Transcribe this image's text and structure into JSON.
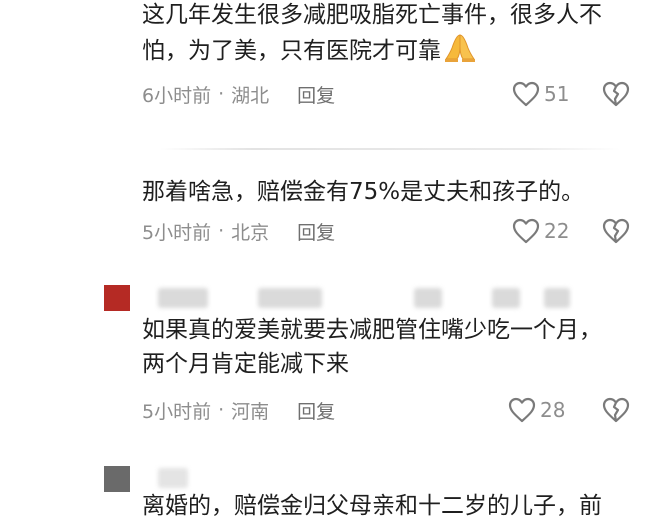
{
  "comments": [
    {
      "text": "这几年发生很多减肥吸脂死亡事件，很多人不\n怕，为了美，只有医院才可靠",
      "emoji": "pray-icon",
      "time": "6小时前",
      "separator": "·",
      "location": "湖北",
      "reply_label": "回复",
      "likes": "51"
    },
    {
      "text": "那着啥急，赔偿金有75%是丈夫和孩子的。",
      "time": "5小时前",
      "separator": "·",
      "location": "北京",
      "reply_label": "回复",
      "likes": "22"
    },
    {
      "text": "如果真的爱美就要去减肥管住嘴少吃一个月，\n两个月肯定能减下来",
      "time": "5小时前",
      "separator": "·",
      "location": "河南",
      "reply_label": "回复",
      "likes": "28",
      "avatar_color": "#b52a24"
    },
    {
      "text": "离婚的，赔偿金归父母亲和十二岁的儿子，前",
      "avatar_color": "#6a6a6a"
    }
  ],
  "colors": {
    "text": "#1f1f1f",
    "meta": "#8d8d8d",
    "icon_stroke": "#7a7a7a"
  },
  "icons": {
    "like": "heart-outline-icon",
    "dislike": "broken-heart-icon"
  }
}
